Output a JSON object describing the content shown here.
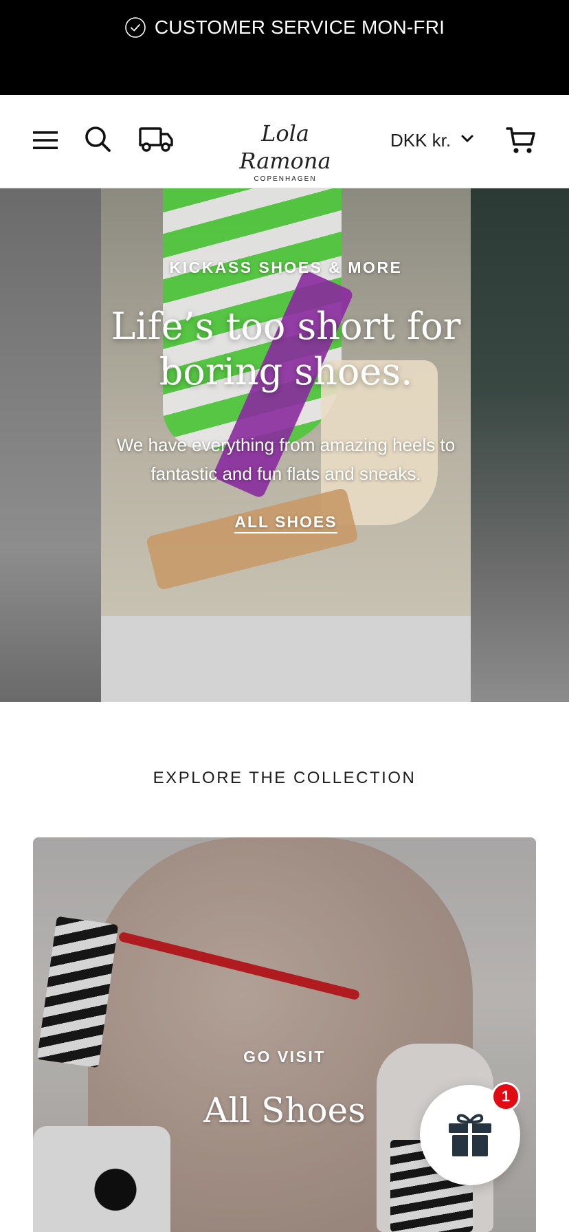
{
  "announcement": {
    "icon": "check-circle-icon",
    "text": "CUSTOMER SERVICE MON-FRI"
  },
  "header": {
    "icons": [
      "menu-icon",
      "search-icon",
      "truck-icon",
      "cart-icon"
    ],
    "logo": {
      "script": "Lola Ramona",
      "sub": "COPENHAGEN"
    },
    "currency": {
      "selected": "DKK kr."
    }
  },
  "hero": {
    "eyebrow": "KICKASS SHOES & MORE",
    "title": "Life’s too short for boring shoes.",
    "text": "We have everything from amazing heels to fantastic and fun flats and sneaks.",
    "link": "ALL SHOES"
  },
  "collection": {
    "heading": "EXPLORE THE COLLECTION",
    "card": {
      "eyebrow": "GO VISIT",
      "title": "All Shoes"
    }
  },
  "gift": {
    "icon": "gift-icon",
    "badge": "1",
    "badge_color": "#e00b13"
  }
}
